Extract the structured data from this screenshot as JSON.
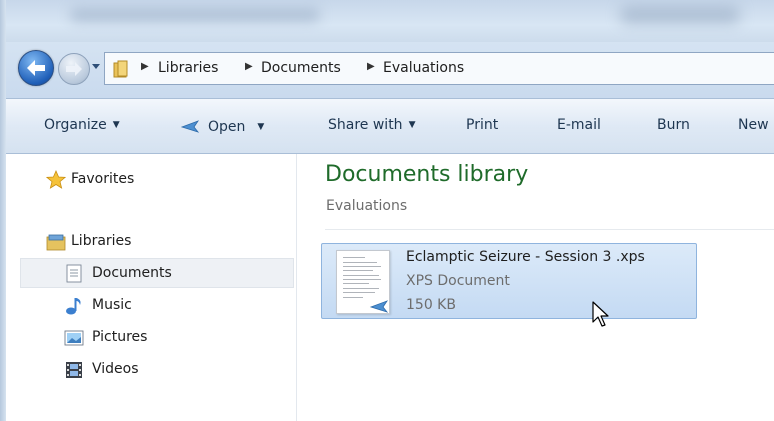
{
  "breadcrumb": [
    "Libraries",
    "Documents",
    "Evaluations"
  ],
  "toolbar": {
    "organize": "Organize",
    "open": "Open",
    "share_with": "Share with",
    "print": "Print",
    "email": "E-mail",
    "burn": "Burn",
    "new_folder": "New"
  },
  "nav": {
    "favorites": "Favorites",
    "libraries": "Libraries",
    "documents": "Documents",
    "music": "Music",
    "pictures": "Pictures",
    "videos": "Videos"
  },
  "content": {
    "title": "Documents library",
    "subtitle": "Evaluations"
  },
  "file": {
    "name": "Eclamptic Seizure - Session 3 .xps",
    "type": "XPS Document",
    "size": "150 KB"
  },
  "colors": {
    "library_title": "#1f6b2a",
    "selection": "#c4daf3",
    "toolbar_text": "#1e3651"
  }
}
